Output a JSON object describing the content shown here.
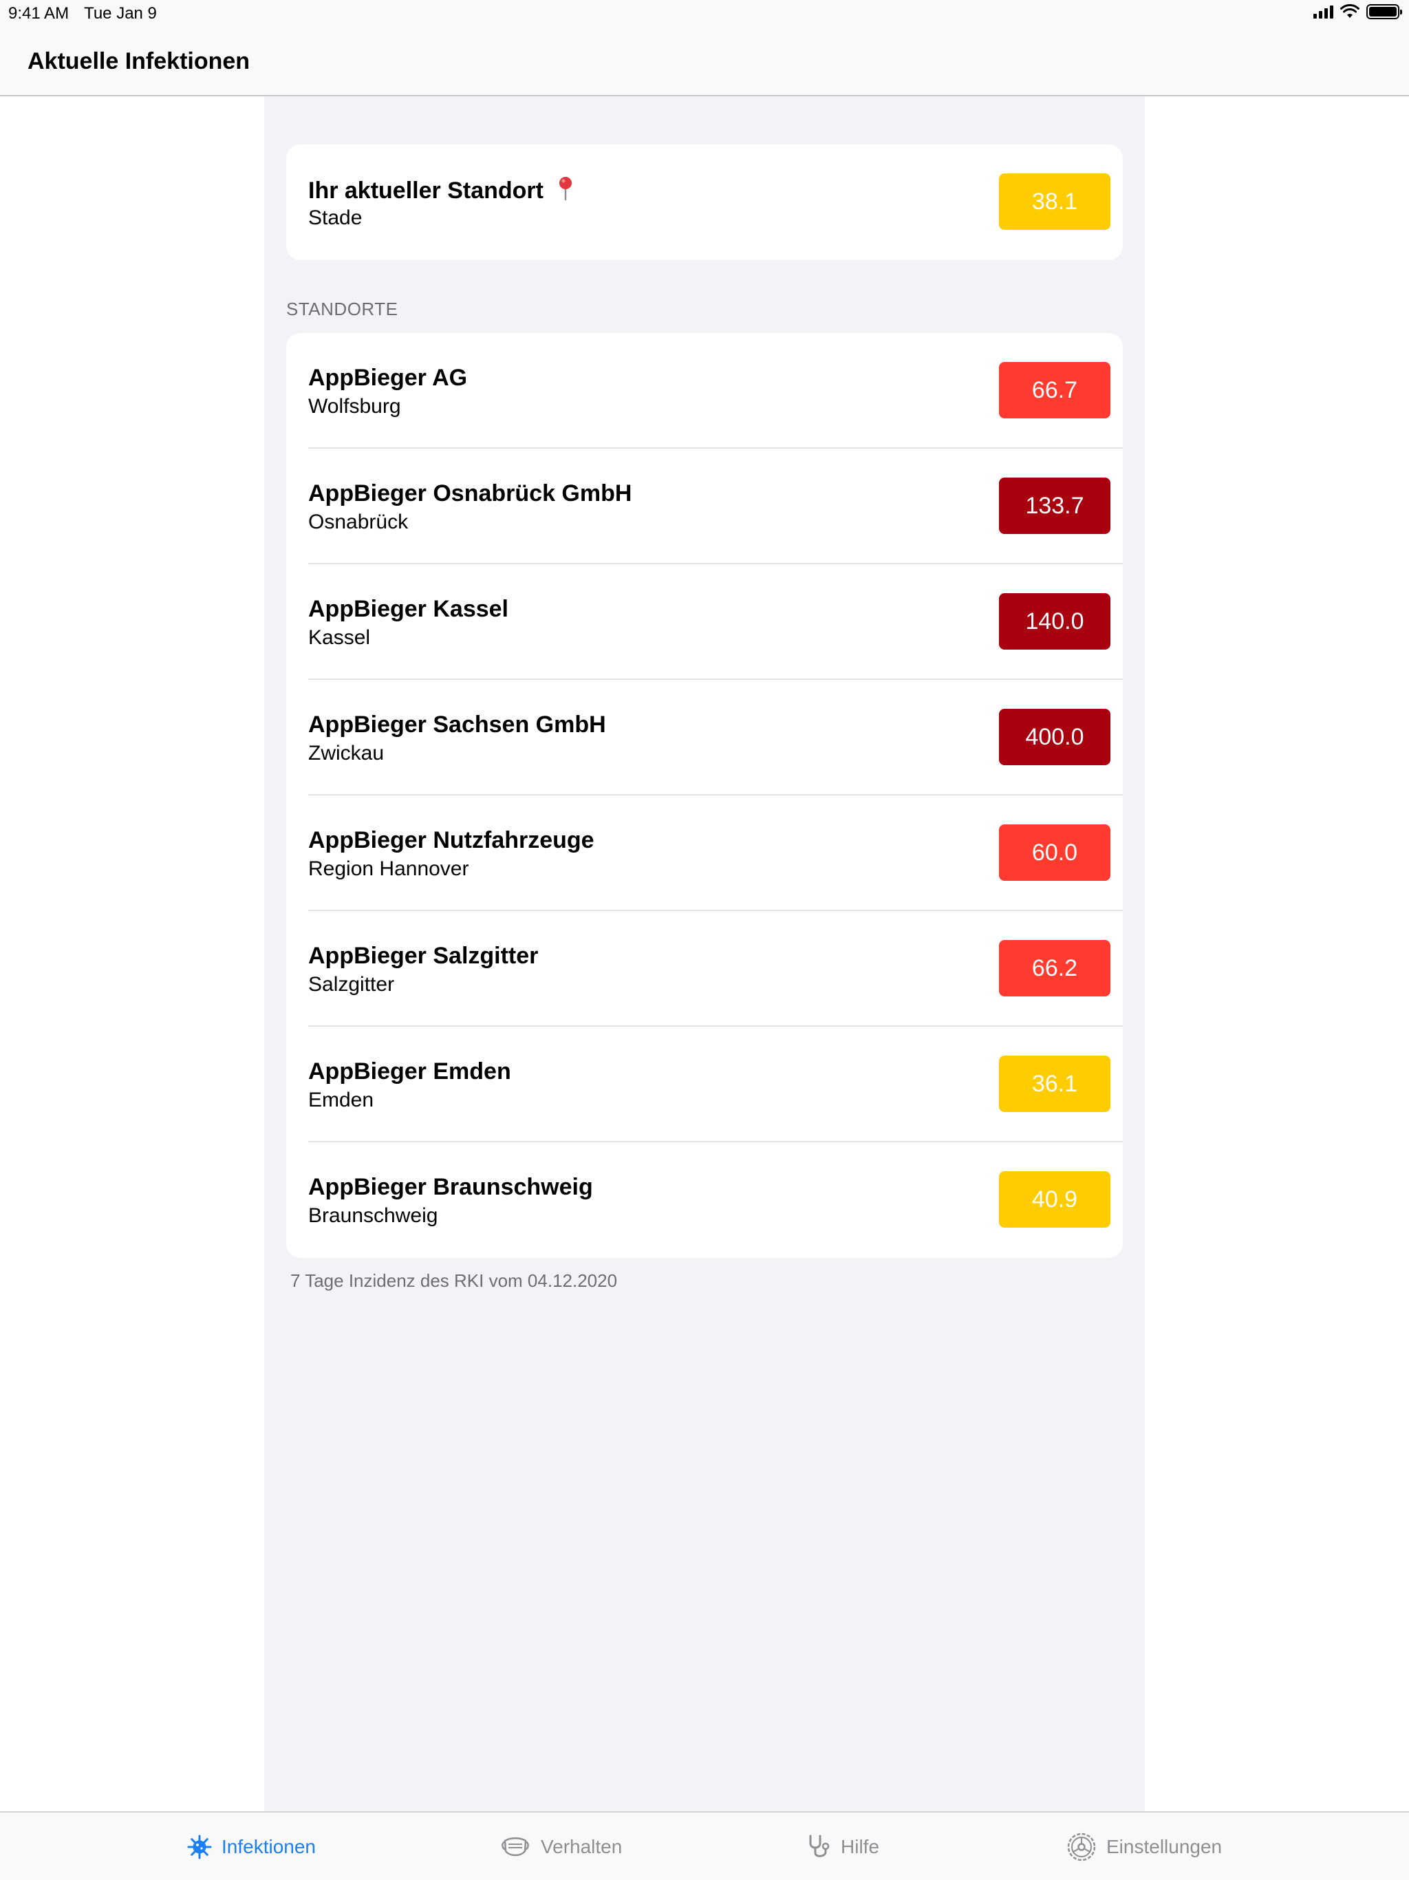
{
  "status_bar": {
    "time": "9:41 AM",
    "date": "Tue Jan 9"
  },
  "nav": {
    "title": "Aktuelle Infektionen"
  },
  "current_location": {
    "title": "Ihr aktueller Standort",
    "city": "Stade",
    "value": "38.1",
    "color": "#ffcc00"
  },
  "section_header": "STANDORTE",
  "locations": [
    {
      "name": "AppBieger AG",
      "city": "Wolfsburg",
      "value": "66.7",
      "color": "#ff3b30"
    },
    {
      "name": "AppBieger Osnabrück GmbH",
      "city": "Osnabrück",
      "value": "133.7",
      "color": "#a8000f"
    },
    {
      "name": "AppBieger Kassel",
      "city": "Kassel",
      "value": "140.0",
      "color": "#a8000f"
    },
    {
      "name": "AppBieger Sachsen GmbH",
      "city": "Zwickau",
      "value": "400.0",
      "color": "#a8000f"
    },
    {
      "name": "AppBieger Nutzfahrzeuge",
      "city": "Region Hannover",
      "value": "60.0",
      "color": "#ff3b30"
    },
    {
      "name": "AppBieger Salzgitter",
      "city": "Salzgitter",
      "value": "66.2",
      "color": "#ff3b30"
    },
    {
      "name": "AppBieger Emden",
      "city": "Emden",
      "value": "36.1",
      "color": "#ffcc00"
    },
    {
      "name": "AppBieger Braunschweig",
      "city": "Braunschweig",
      "value": "40.9",
      "color": "#ffcc00"
    }
  ],
  "footer_note": "7 Tage Inzidenz des RKI vom 04.12.2020",
  "tabs": [
    {
      "label": "Infektionen",
      "icon": "virus-icon",
      "active": true
    },
    {
      "label": "Verhalten",
      "icon": "mask-icon",
      "active": false
    },
    {
      "label": "Hilfe",
      "icon": "stethoscope-icon",
      "active": false
    },
    {
      "label": "Einstellungen",
      "icon": "gear-icon",
      "active": false
    }
  ],
  "colors": {
    "accent": "#1a7ef4",
    "yellow": "#ffcc00",
    "red": "#ff3b30",
    "dark_red": "#a8000f"
  }
}
